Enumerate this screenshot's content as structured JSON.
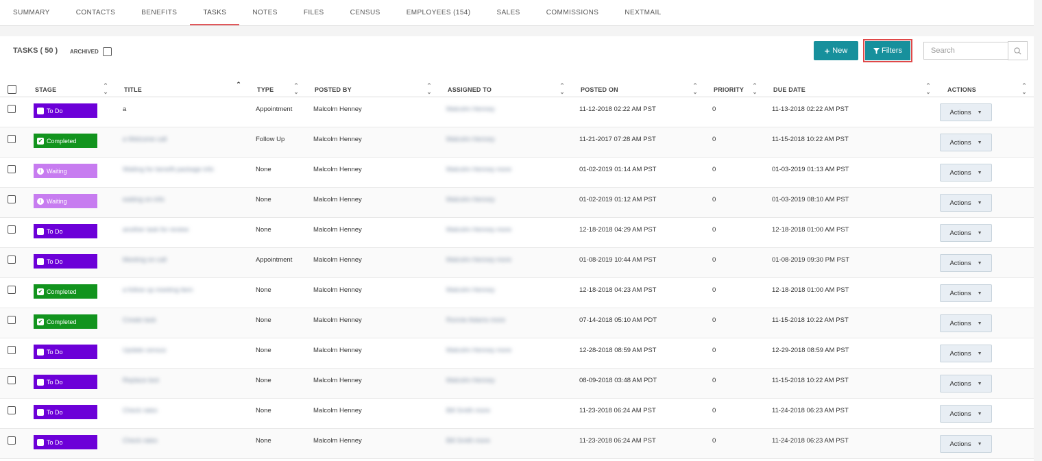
{
  "tabs": [
    {
      "label": "SUMMARY",
      "active": false
    },
    {
      "label": "CONTACTS",
      "active": false
    },
    {
      "label": "BENEFITS",
      "active": false
    },
    {
      "label": "TASKS",
      "active": true
    },
    {
      "label": "NOTES",
      "active": false
    },
    {
      "label": "FILES",
      "active": false
    },
    {
      "label": "CENSUS",
      "active": false
    },
    {
      "label": "EMPLOYEES (154)",
      "active": false
    },
    {
      "label": "SALES",
      "active": false
    },
    {
      "label": "COMMISSIONS",
      "active": false
    },
    {
      "label": "NEXTMAIL",
      "active": false
    }
  ],
  "panel": {
    "title": "TASKS ( 50 )",
    "archived_label": "ARCHIVED",
    "new_label": "New",
    "filters_label": "Filters",
    "search_placeholder": "Search"
  },
  "columns": [
    "STAGE",
    "TITLE",
    "TYPE",
    "POSTED BY",
    "ASSIGNED TO",
    "POSTED ON",
    "PRIORITY",
    "DUE DATE",
    "ACTIONS"
  ],
  "stage_colors": {
    "todo": "#6c00d8",
    "completed": "#12941e",
    "waiting": "#c77cf0"
  },
  "accent": "#17909c",
  "rows": [
    {
      "stage": "To Do",
      "stage_key": "todo",
      "title": "a",
      "title_blur": false,
      "type": "Appointment",
      "posted_by": "Malcolm Henney",
      "assigned_to": "Malcolm Henney",
      "posted_on": "11-12-2018 02:22 AM PST",
      "priority": "0",
      "due_date": "11-13-2018 02:22 AM PST",
      "action": "Actions"
    },
    {
      "stage": "Completed",
      "stage_key": "completed",
      "title": "a Welcome call",
      "title_blur": true,
      "type": "Follow Up",
      "posted_by": "Malcolm Henney",
      "assigned_to": "Malcolm Henney",
      "posted_on": "11-21-2017 07:28 AM PST",
      "priority": "0",
      "due_date": "11-15-2018 10:22 AM PST",
      "action": "Actions"
    },
    {
      "stage": "Waiting",
      "stage_key": "waiting",
      "title": "Waiting for benefit package info",
      "title_blur": true,
      "type": "None",
      "posted_by": "Malcolm Henney",
      "assigned_to": "Malcolm Henney more",
      "posted_on": "01-02-2019 01:14 AM PST",
      "priority": "0",
      "due_date": "01-03-2019 01:13 AM PST",
      "action": "Actions"
    },
    {
      "stage": "Waiting",
      "stage_key": "waiting",
      "title": "waiting on info",
      "title_blur": true,
      "type": "None",
      "posted_by": "Malcolm Henney",
      "assigned_to": "Malcolm Henney",
      "posted_on": "01-02-2019 01:12 AM PST",
      "priority": "0",
      "due_date": "01-03-2019 08:10 AM PST",
      "action": "Actions"
    },
    {
      "stage": "To Do",
      "stage_key": "todo",
      "title": "another task for review",
      "title_blur": true,
      "type": "None",
      "posted_by": "Malcolm Henney",
      "assigned_to": "Malcolm Henney more",
      "posted_on": "12-18-2018 04:29 AM PST",
      "priority": "0",
      "due_date": "12-18-2018 01:00 AM PST",
      "action": "Actions"
    },
    {
      "stage": "To Do",
      "stage_key": "todo",
      "title": "Meeting on call",
      "title_blur": true,
      "type": "Appointment",
      "posted_by": "Malcolm Henney",
      "assigned_to": "Malcolm Henney more",
      "posted_on": "01-08-2019 10:44 AM PST",
      "priority": "0",
      "due_date": "01-08-2019 09:30 PM PST",
      "action": "Actions"
    },
    {
      "stage": "Completed",
      "stage_key": "completed",
      "title": "a follow up meeting item",
      "title_blur": true,
      "type": "None",
      "posted_by": "Malcolm Henney",
      "assigned_to": "Malcolm Henney",
      "posted_on": "12-18-2018 04:23 AM PST",
      "priority": "0",
      "due_date": "12-18-2018 01:00 AM PST",
      "action": "Actions"
    },
    {
      "stage": "Completed",
      "stage_key": "completed",
      "title": "Create task",
      "title_blur": true,
      "type": "None",
      "posted_by": "Malcolm Henney",
      "assigned_to": "Ronnie Adams more",
      "posted_on": "07-14-2018 05:10 AM PDT",
      "priority": "0",
      "due_date": "11-15-2018 10:22 AM PST",
      "action": "Actions"
    },
    {
      "stage": "To Do",
      "stage_key": "todo",
      "title": "Update census",
      "title_blur": true,
      "type": "None",
      "posted_by": "Malcolm Henney",
      "assigned_to": "Malcolm Henney more",
      "posted_on": "12-28-2018 08:59 AM PST",
      "priority": "0",
      "due_date": "12-29-2018 08:59 AM PST",
      "action": "Actions"
    },
    {
      "stage": "To Do",
      "stage_key": "todo",
      "title": "Replace test",
      "title_blur": true,
      "type": "None",
      "posted_by": "Malcolm Henney",
      "assigned_to": "Malcolm Henney",
      "posted_on": "08-09-2018 03:48 AM PDT",
      "priority": "0",
      "due_date": "11-15-2018 10:22 AM PST",
      "action": "Actions"
    },
    {
      "stage": "To Do",
      "stage_key": "todo",
      "title": "Check rates",
      "title_blur": true,
      "type": "None",
      "posted_by": "Malcolm Henney",
      "assigned_to": "Bill Smith more",
      "posted_on": "11-23-2018 06:24 AM PST",
      "priority": "0",
      "due_date": "11-24-2018 06:23 AM PST",
      "action": "Actions"
    },
    {
      "stage": "To Do",
      "stage_key": "todo",
      "title": "Check rates",
      "title_blur": true,
      "type": "None",
      "posted_by": "Malcolm Henney",
      "assigned_to": "Bill Smith more",
      "posted_on": "11-23-2018 06:24 AM PST",
      "priority": "0",
      "due_date": "11-24-2018 06:23 AM PST",
      "action": "Actions"
    }
  ]
}
